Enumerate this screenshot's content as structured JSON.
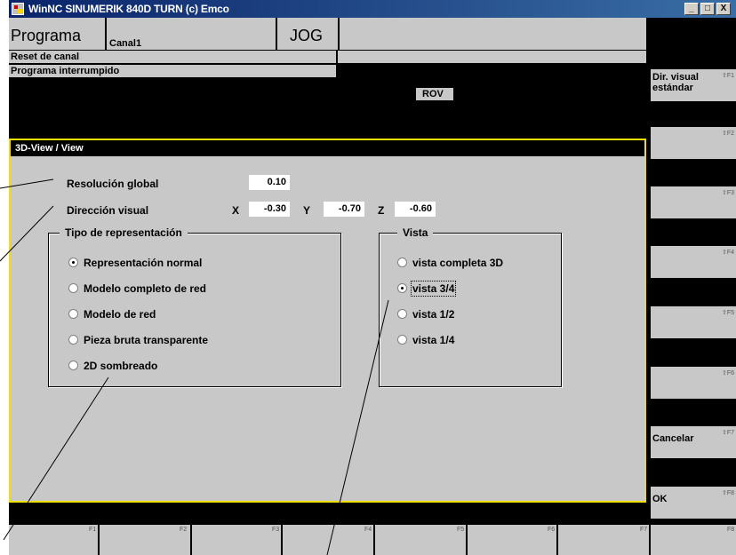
{
  "window": {
    "title": "WinNC SINUMERIK 840D TURN (c) Emco",
    "buttons": [
      "_",
      "□",
      "X"
    ]
  },
  "header": {
    "area": "Programa",
    "channel": "Canal1",
    "mode": "JOG"
  },
  "status": {
    "reset": "Reset de canal",
    "state": "Programa interrumpido",
    "rov": "ROV"
  },
  "panel": {
    "title": "3D-View / View",
    "resolution": {
      "label": "Resolución global",
      "value": "0.10"
    },
    "direction": {
      "label": "Dirección visual",
      "x_label": "X",
      "x": "-0.30",
      "y_label": "Y",
      "y": "-0.70",
      "z_label": "Z",
      "z": "-0.60"
    },
    "representation": {
      "legend": "Tipo de representación",
      "options": [
        "Representación normal",
        "Modelo completo de red",
        "Modelo de red",
        "Pieza bruta transparente",
        "2D sombreado"
      ],
      "selected": 0
    },
    "view": {
      "legend": "Vista",
      "options": [
        "vista completa 3D",
        "vista 3/4",
        "vista 1/2",
        "vista 1/4"
      ],
      "selected": 1
    }
  },
  "softkeys_right": [
    {
      "label": "Dir. visual estándar",
      "fkey": "⇧F1"
    },
    {
      "label": "",
      "fkey": "⇧F2"
    },
    {
      "label": "",
      "fkey": "⇧F3"
    },
    {
      "label": "",
      "fkey": "⇧F4"
    },
    {
      "label": "",
      "fkey": "⇧F5"
    },
    {
      "label": "",
      "fkey": "⇧F6"
    },
    {
      "label": "Cancelar",
      "fkey": "⇧F7"
    },
    {
      "label": "OK",
      "fkey": "⇧F8"
    }
  ],
  "softkeys_bottom": [
    "F1",
    "F2",
    "F3",
    "F4",
    "F5",
    "F6",
    "F7",
    "F8"
  ]
}
